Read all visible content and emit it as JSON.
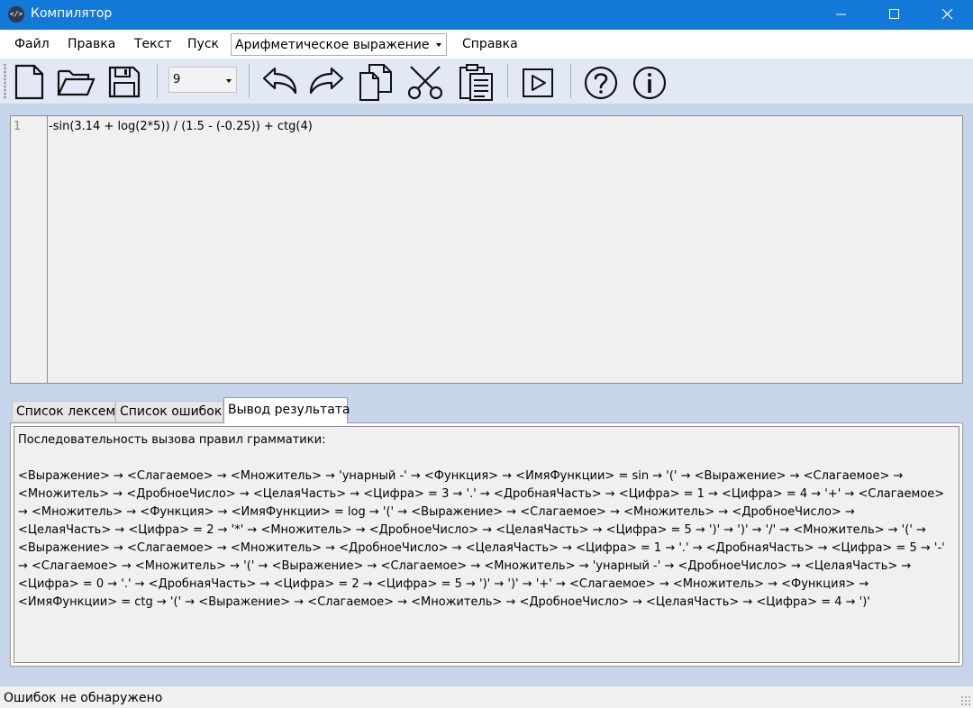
{
  "window": {
    "title": "Компилятор",
    "app_icon": "</>"
  },
  "menu": {
    "items": [
      "Файл",
      "Правка",
      "Текст",
      "Пуск"
    ],
    "grammar_select": "Арифметическое выражение",
    "help": "Справка"
  },
  "toolbar": {
    "icons": [
      "new-file-icon",
      "open-folder-icon",
      "save-disk-icon",
      "undo-icon",
      "redo-icon",
      "copy-icon",
      "cut-scissors-icon",
      "paste-clipboard-icon",
      "run-play-icon",
      "help-question-icon",
      "info-icon"
    ],
    "font_size": "9"
  },
  "editor": {
    "line_numbers": [
      "1"
    ],
    "lines": [
      "-sin(3.14 + log(2*5)) / (1.5 - (-0.25)) + ctg(4)"
    ]
  },
  "tabs": [
    {
      "label": "Список лексем",
      "active": false
    },
    {
      "label": "Список ошибок",
      "active": false
    },
    {
      "label": "Вывод результата",
      "active": true
    }
  ],
  "output": {
    "lines": [
      "Последовательность вызова правил грамматики:",
      "",
      "<Выражение> → <Слагаемое> → <Множитель> → 'унарный -' → <Функция> → <ИмяФункции> = sin → '(' → <Выражение> → <Слагаемое> →",
      "<Множитель> → <ДробноеЧисло> → <ЦелаяЧасть> → <Цифра> = 3 → '.' → <ДробнаяЧасть> → <Цифра> = 1 → <Цифра> = 4 → '+' → <Слагаемое>",
      "→ <Множитель> → <Функция> → <ИмяФункции> = log → '(' → <Выражение> → <Слагаемое> → <Множитель> → <ДробноеЧисло> →",
      "<ЦелаяЧасть> → <Цифра> = 2 → '*' → <Множитель> → <ДробноеЧисло> → <ЦелаяЧасть> → <Цифра> = 5 → ')' → ')' → '/' → <Множитель> → '(' →",
      "<Выражение> → <Слагаемое> → <Множитель> → <ДробноеЧисло> → <ЦелаяЧасть> → <Цифра> = 1 → '.' → <ДробнаяЧасть> → <Цифра> = 5 → '-'",
      "→ <Слагаемое> → <Множитель> → '(' → <Выражение> → <Слагаемое> → <Множитель> → 'унарный -' → <ДробноеЧисло> → <ЦелаяЧасть> →",
      "<Цифра> = 0 → '.' → <ДробнаяЧасть> → <Цифра> = 2 → <Цифра> = 5 → ')' → ')' → '+' → <Слагаемое> → <Множитель> → <Функция> →",
      "<ИмяФункции> = ctg → '(' → <Выражение> → <Слагаемое> → <Множитель> → <ДробноеЧисло> → <ЦелаяЧасть> → <Цифра> = 4 → ')'"
    ]
  },
  "status": {
    "text": "Ошибок не обнаружено"
  },
  "colors": {
    "titlebar": "#1379d9",
    "background": "#c7d5ea",
    "toolbar": "#e3e8f6"
  }
}
